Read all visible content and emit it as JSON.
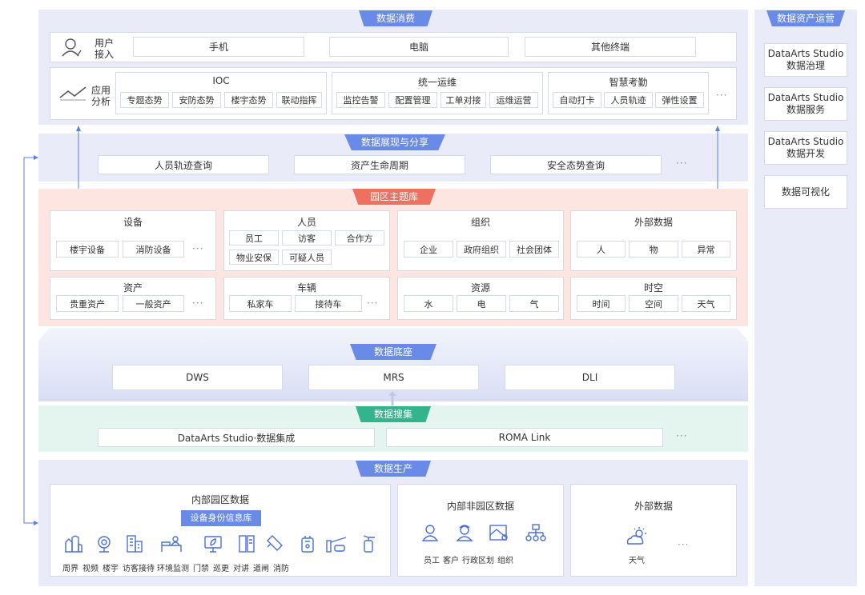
{
  "consume": {
    "tab": "数据消费",
    "user_label": [
      "用户",
      "接入"
    ],
    "terminals": [
      "手机",
      "电脑",
      "其他终端"
    ],
    "app_label": [
      "应用",
      "分析"
    ],
    "groups": [
      {
        "title": "IOC",
        "items": [
          "专题态势",
          "安防态势",
          "楼宇态势",
          "联动指挥"
        ]
      },
      {
        "title": "统一运维",
        "items": [
          "监控告警",
          "配置管理",
          "工单对接",
          "运维运营"
        ]
      },
      {
        "title": "智慧考勤",
        "items": [
          "自动打卡",
          "人员轨迹",
          "弹性设置"
        ]
      }
    ],
    "more": "···"
  },
  "display": {
    "tab": "数据展现与分享",
    "items": [
      "人员轨迹查询",
      "资产生命周期",
      "安全态势查询"
    ],
    "more": "···"
  },
  "theme": {
    "tab": "园区主题库",
    "cards": {
      "device": {
        "title": "设备",
        "items": [
          "楼宇设备",
          "消防设备"
        ],
        "more": "···"
      },
      "people": {
        "title": "人员",
        "items": [
          "员工",
          "访客",
          "合作方",
          "物业安保",
          "可疑人员"
        ]
      },
      "org": {
        "title": "组织",
        "items": [
          "企业",
          "政府组织",
          "社会团体"
        ]
      },
      "external": {
        "title": "外部数据",
        "items": [
          "人",
          "物",
          "异常"
        ]
      },
      "asset": {
        "title": "资产",
        "items": [
          "贵重资产",
          "一般资产"
        ],
        "more": "···"
      },
      "vehicle": {
        "title": "车辆",
        "items": [
          "私家车",
          "接待车"
        ],
        "more": "···"
      },
      "resource": {
        "title": "资源",
        "items": [
          "水",
          "电",
          "气"
        ]
      },
      "spacetime": {
        "title": "时空",
        "items": [
          "时间",
          "空间",
          "天气"
        ]
      }
    }
  },
  "base": {
    "tab": "数据底座",
    "items": [
      "DWS",
      "MRS",
      "DLI"
    ]
  },
  "collect": {
    "tab": "数据搜集",
    "items": [
      "DataArts Studio·数据集成",
      "ROMA Link"
    ],
    "more": "···"
  },
  "produce": {
    "tab": "数据生产",
    "internal": {
      "title": "内部园区数据",
      "badge": "设备身份信息库",
      "labels": [
        "周界",
        "视频",
        "楼宇",
        "访客接待",
        "环境监测",
        "门禁",
        "巡更",
        "对讲",
        "道闸",
        "消防"
      ]
    },
    "internal_non": {
      "title": "内部非园区数据",
      "labels": [
        "员工",
        "客户",
        "行政区划",
        "组织"
      ]
    },
    "external": {
      "title": "外部数据",
      "label": "天气",
      "more": "···"
    }
  },
  "side": {
    "tab": "数据资产运营",
    "items": [
      [
        "DataArts Studio",
        "数据治理"
      ],
      [
        "DataArts Studio",
        "数据服务"
      ],
      [
        "DataArts Studio",
        "数据开发"
      ],
      [
        "数据可视化"
      ]
    ]
  },
  "colors": {
    "blue": "#6a8ae8",
    "red": "#ee7060",
    "green": "#33b48c",
    "icon": "#4a6fd8"
  }
}
